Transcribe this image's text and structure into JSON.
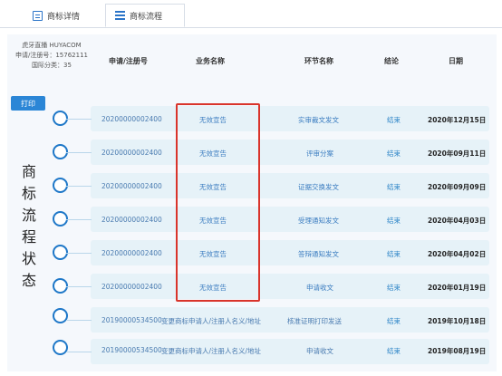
{
  "tabs": [
    {
      "label": "商标详情",
      "active": false,
      "icon": "document-icon"
    },
    {
      "label": "商标流程",
      "active": true,
      "icon": "list-icon"
    }
  ],
  "info": {
    "name": "虎牙直播 HUYACOM",
    "reg_no": "申请/注册号：15762111",
    "intl_class": "国际分类：35"
  },
  "columns": [
    "申请/注册号",
    "业务名称",
    "环节名称",
    "结论",
    "日期"
  ],
  "print_label": "打印",
  "side_label": [
    "商",
    "标",
    "流",
    "程",
    "状",
    "态"
  ],
  "rows": [
    {
      "reg_no": "20200000002400",
      "business": "无效宣告",
      "stage": "实审裁文发文",
      "result": "结束",
      "date": "2020年12月15日"
    },
    {
      "reg_no": "20200000002400",
      "business": "无效宣告",
      "stage": "评审分案",
      "result": "结束",
      "date": "2020年09月11日"
    },
    {
      "reg_no": "20200000002400",
      "business": "无效宣告",
      "stage": "证据交换发文",
      "result": "结束",
      "date": "2020年09月09日"
    },
    {
      "reg_no": "20200000002400",
      "business": "无效宣告",
      "stage": "受理通知发文",
      "result": "结束",
      "date": "2020年04月03日"
    },
    {
      "reg_no": "20200000002400",
      "business": "无效宣告",
      "stage": "答辩通知发文",
      "result": "结束",
      "date": "2020年04月02日"
    },
    {
      "reg_no": "20200000002400",
      "business": "无效宣告",
      "stage": "申请收文",
      "result": "结束",
      "date": "2020年01月19日"
    },
    {
      "reg_no": "20190000534500",
      "business": "变更商标申请人/注册人名义/地址",
      "stage": "核准证明打印发送",
      "result": "结束",
      "date": "2019年10月18日"
    },
    {
      "reg_no": "20190000534500",
      "business": "变更商标申请人/注册人名义/地址",
      "stage": "申请收文",
      "result": "结束",
      "date": "2019年08月19日"
    }
  ],
  "colors": {
    "accent": "#2b86d6",
    "row_bg": "#e6f2f8",
    "highlight": "#d9342b"
  }
}
